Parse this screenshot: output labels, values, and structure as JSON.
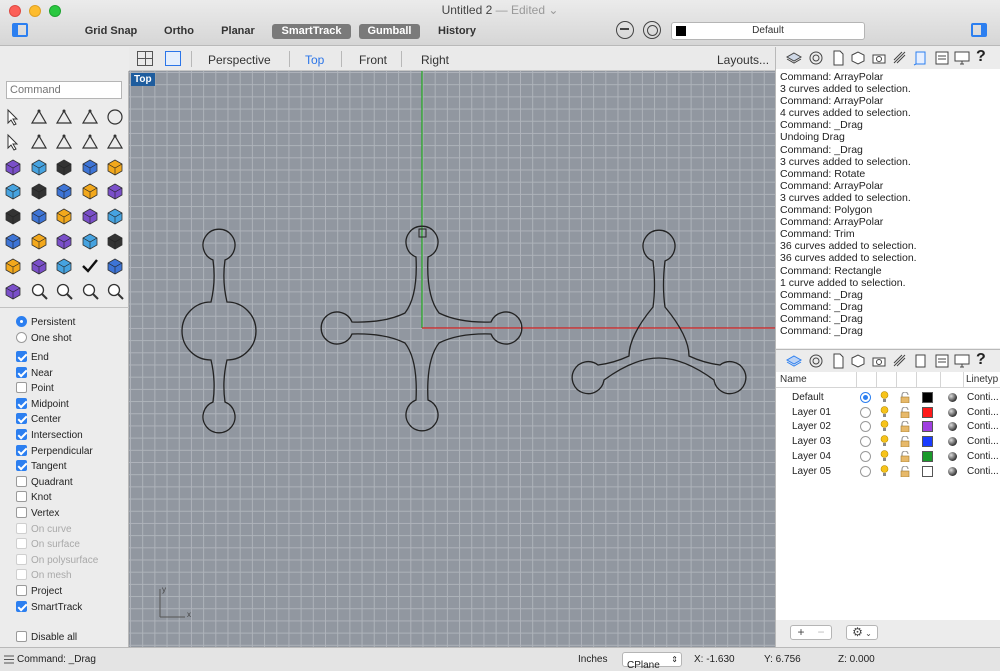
{
  "window": {
    "title": "Untitled 2",
    "status": "Edited",
    "separator": "—"
  },
  "toolbar": {
    "buttons": [
      {
        "label": "Grid Snap",
        "on": false
      },
      {
        "label": "Ortho",
        "on": false
      },
      {
        "label": "Planar",
        "on": false
      },
      {
        "label": "SmartTrack",
        "on": true
      },
      {
        "label": "Gumball",
        "on": true
      },
      {
        "label": "History",
        "on": false
      }
    ],
    "current_layer": "Default"
  },
  "viewport_tabs": {
    "tabs": [
      "Perspective",
      "Top",
      "Front",
      "Right"
    ],
    "active": "Top",
    "layouts_label": "Layouts..."
  },
  "viewport": {
    "label": "Top",
    "axis_x_label": "x",
    "axis_y_label": "y"
  },
  "command": {
    "placeholder": "Command"
  },
  "osnaps": {
    "mode": [
      {
        "label": "Persistent",
        "selected": true
      },
      {
        "label": "One shot",
        "selected": false
      }
    ],
    "items": [
      {
        "label": "End",
        "checked": true,
        "disabled": false
      },
      {
        "label": "Near",
        "checked": true,
        "disabled": false
      },
      {
        "label": "Point",
        "checked": false,
        "disabled": false
      },
      {
        "label": "Midpoint",
        "checked": true,
        "disabled": false
      },
      {
        "label": "Center",
        "checked": true,
        "disabled": false
      },
      {
        "label": "Intersection",
        "checked": true,
        "disabled": false
      },
      {
        "label": "Perpendicular",
        "checked": true,
        "disabled": false
      },
      {
        "label": "Tangent",
        "checked": true,
        "disabled": false
      },
      {
        "label": "Quadrant",
        "checked": false,
        "disabled": false
      },
      {
        "label": "Knot",
        "checked": false,
        "disabled": false
      },
      {
        "label": "Vertex",
        "checked": false,
        "disabled": false
      },
      {
        "label": "On curve",
        "checked": false,
        "disabled": true
      },
      {
        "label": "On surface",
        "checked": false,
        "disabled": true
      },
      {
        "label": "On polysurface",
        "checked": false,
        "disabled": true
      },
      {
        "label": "On mesh",
        "checked": false,
        "disabled": true
      },
      {
        "label": "Project",
        "checked": false,
        "disabled": false
      },
      {
        "label": "SmartTrack",
        "checked": true,
        "disabled": false
      }
    ],
    "disable_all": {
      "label": "Disable all",
      "checked": false
    }
  },
  "history": [
    "Command: ArrayPolar",
    "3 curves added to selection.",
    "Command: ArrayPolar",
    "4 curves added to selection.",
    "Command: _Drag",
    "Undoing Drag",
    "Command: _Drag",
    "3 curves added to selection.",
    "Command: Rotate",
    "Command: ArrayPolar",
    "3 curves added to selection.",
    "Command: Polygon",
    "Command: ArrayPolar",
    "Command: Trim",
    "36 curves added to selection.",
    "36 curves added to selection.",
    "Command: Rectangle",
    "1 curve added to selection.",
    "Command: _Drag",
    "Command: _Drag",
    "Command: _Drag",
    "Command: _Drag"
  ],
  "layers": {
    "columns": {
      "name": "Name",
      "linetype": "Linetyp"
    },
    "rows": [
      {
        "name": "Default",
        "current": true,
        "color": "#000000",
        "linetype": "Conti..."
      },
      {
        "name": "Layer 01",
        "current": false,
        "color": "#ff1a1a",
        "linetype": "Conti..."
      },
      {
        "name": "Layer 02",
        "current": false,
        "color": "#a040e0",
        "linetype": "Conti..."
      },
      {
        "name": "Layer 03",
        "current": false,
        "color": "#1a3cff",
        "linetype": "Conti..."
      },
      {
        "name": "Layer 04",
        "current": false,
        "color": "#1a9a2a",
        "linetype": "Conti..."
      },
      {
        "name": "Layer 05",
        "current": false,
        "color": "#ffffff",
        "linetype": "Conti..."
      }
    ],
    "footer": {
      "add": "+",
      "remove": "−",
      "gear": "⚙"
    }
  },
  "statusbar": {
    "command": "Command: _Drag",
    "units": "Inches",
    "cplane": "CPlane",
    "x": "X: -1.630",
    "y": "Y: 6.756",
    "z": "Z: 0.000"
  }
}
